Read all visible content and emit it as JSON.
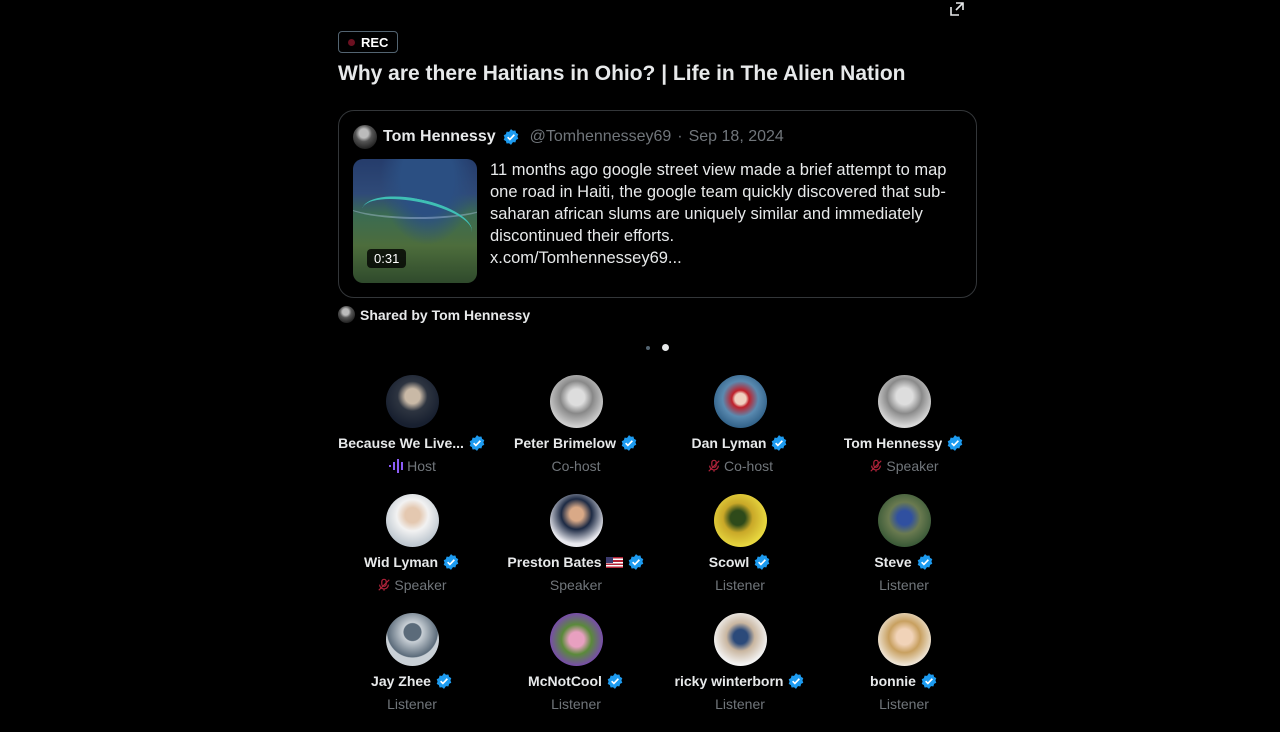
{
  "space": {
    "rec_label": "REC",
    "title": "Why are there Haitians in Ohio? | Life in The Alien Nation"
  },
  "tweet": {
    "author_name": "Tom Hennessy",
    "handle": "@Tomhennessey69",
    "separator": "·",
    "date": "Sep 18, 2024",
    "video_duration": "0:31",
    "text": "11 months ago google street view made a brief attempt to map one road in Haiti, the google team quickly discovered that sub-saharan african slums are uniquely similar and immediately discontinued their efforts.",
    "link": "x.com/Tomhennessey69..."
  },
  "shared_by": "Shared by Tom Hennessy",
  "colors": {
    "verified": "#1d9bf0",
    "muted_mic": "#b0233a",
    "speaking": "#8b5cf6",
    "secondary_text": "#71767b"
  },
  "participants": [
    {
      "name": "Because We Live...",
      "role": "Host",
      "role_icon": "speaking-wave-icon"
    },
    {
      "name": "Peter Brimelow",
      "role": "Co-host",
      "role_icon": ""
    },
    {
      "name": "Dan Lyman",
      "role": "Co-host",
      "role_icon": "mic-muted-icon"
    },
    {
      "name": "Tom Hennessy",
      "role": "Speaker",
      "role_icon": "mic-muted-icon"
    },
    {
      "name": "Wid Lyman",
      "role": "Speaker",
      "role_icon": "mic-muted-icon"
    },
    {
      "name": "Preston Bates",
      "role": "Speaker",
      "role_icon": "",
      "flag": "us-flag-icon"
    },
    {
      "name": "Scowl",
      "role": "Listener",
      "role_icon": ""
    },
    {
      "name": "Steve",
      "role": "Listener",
      "role_icon": ""
    },
    {
      "name": "Jay Zhee",
      "role": "Listener",
      "role_icon": ""
    },
    {
      "name": "McNotCool",
      "role": "Listener",
      "role_icon": ""
    },
    {
      "name": "ricky winterborn",
      "role": "Listener",
      "role_icon": ""
    },
    {
      "name": "bonnie",
      "role": "Listener",
      "role_icon": ""
    }
  ]
}
